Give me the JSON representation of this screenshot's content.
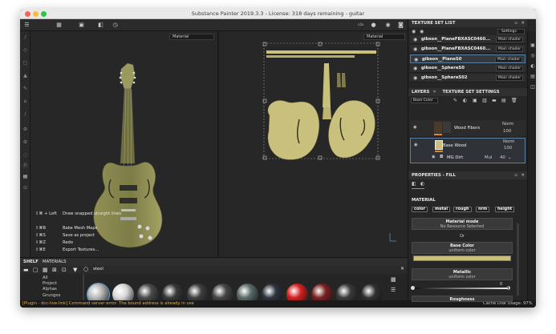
{
  "window": {
    "title": "Substance Painter 2019.3.3 - License: 318 days remaining - guitar"
  },
  "toolbar": {
    "icons": [
      "grid-icon",
      "layout-icon",
      "camera-icon",
      "history-icon"
    ],
    "right_icons": [
      "display-icon",
      "material-ball-icon",
      "render-icon",
      "screenshot-icon"
    ],
    "badge": "c/a"
  },
  "viewport_3d": {
    "channel_select": "Material"
  },
  "viewport_2d": {
    "channel_select": "Material"
  },
  "shortcuts": [
    {
      "keys": "⇧⌘ + Left",
      "label": "Draw snapped straight lines"
    },
    {
      "keys": "⇧⌘B",
      "label": "Bake Mesh Maps"
    },
    {
      "keys": "⇧⌘S",
      "label": "Save as project"
    },
    {
      "keys": "⇧⌘Z",
      "label": "Redo"
    },
    {
      "keys": "⇧⌘E",
      "label": "Export Textures..."
    }
  ],
  "shelf": {
    "tabs": [
      "SHELF",
      "MATERIALS"
    ],
    "search_value": "steel",
    "categories": [
      "All",
      "Project",
      "Alphas",
      "Grunges"
    ],
    "materials": [
      {
        "color": "#b8b8b8"
      },
      {
        "color": "#d8d8d8"
      },
      {
        "color": "#4a4a4a"
      },
      {
        "color": "#383838"
      },
      {
        "color": "#3e3e3e"
      },
      {
        "color": "#444444"
      },
      {
        "color": "#5a6a6a"
      },
      {
        "color": "#2e3440"
      },
      {
        "color": "#d42020"
      },
      {
        "color": "#7a2020"
      },
      {
        "color": "#3a3a3a"
      },
      {
        "color": "#303030"
      }
    ]
  },
  "status": {
    "message": "[Plugin - dcc-live-link] Command server error: The bound address is already in use",
    "cache_label": "Cache Disk Usage:",
    "cache_value": "97%"
  },
  "texture_set_list": {
    "title": "TEXTURE SET LIST",
    "settings_label": "Settings",
    "rows": [
      {
        "name": "gibson__PlaneFBXASC0460...",
        "shader": "Main shader"
      },
      {
        "name": "gibson__PlaneFBXASC0460...",
        "shader": "Main shader"
      },
      {
        "name": "gibson__PlaneS0",
        "shader": "Main shader"
      },
      {
        "name": "gibson__SphereS0",
        "shader": "Main shader"
      },
      {
        "name": "gibson__SphereS02",
        "shader": "Main shader"
      }
    ]
  },
  "layers": {
    "tabs": [
      "LAYERS",
      "TEXTURE SET SETTINGS"
    ],
    "channel_select": "Base Color",
    "items": [
      {
        "name": "Wood Fibers",
        "blend": "Norm",
        "opacity": "100"
      },
      {
        "name": "Base Wood",
        "blend": "Norm",
        "opacity": "100"
      },
      {
        "name": "MG Dirt",
        "blend": "Mul",
        "opacity": "40"
      }
    ]
  },
  "properties": {
    "title": "PROPERTIES - FILL",
    "section": "MATERIAL",
    "channels": [
      "color",
      "metal",
      "rough",
      "nrm",
      "height"
    ],
    "material_mode_label": "Material mode",
    "material_mode_value": "No Resource Selected",
    "or_label": "Or",
    "base_color_label": "Base Color",
    "base_color_value": "uniform color",
    "base_color_swatch": "#c9c07a",
    "metallic_label": "Metallic",
    "metallic_value": "uniform color",
    "metallic_number": "0",
    "roughness_label": "Roughness"
  }
}
